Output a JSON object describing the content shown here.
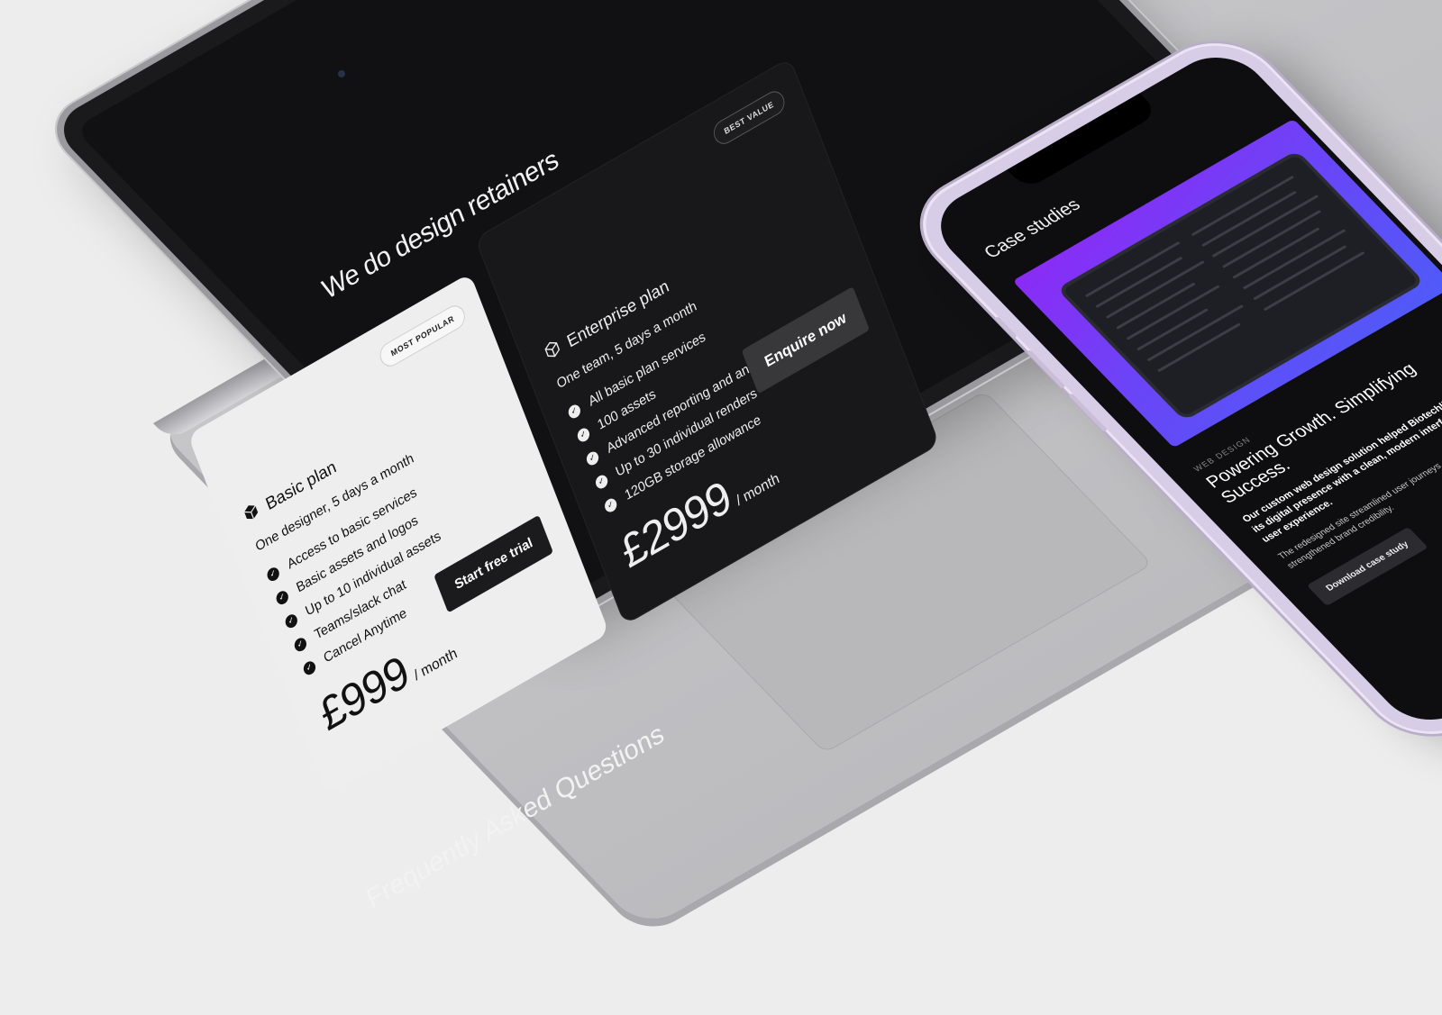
{
  "laptop": {
    "heading": "We do design retainers",
    "faq_heading": "Frequently Asked Questions",
    "plans": [
      {
        "badge": "MOST POPULAR",
        "title": "Basic plan",
        "subtitle": "One designer, 5 days a month",
        "features": [
          "Access to basic services",
          "Basic assets and logos",
          "Up to 10 individual assets",
          "Teams/slack chat",
          "Cancel Anytime"
        ],
        "price": "£999",
        "period": "/ month",
        "cta": "Start free trial"
      },
      {
        "badge": "BEST VALUE",
        "title": "Enterprise plan",
        "subtitle": "One team, 5 days a month",
        "features": [
          "All basic plan services",
          "100 assets",
          "Advanced reporting and analytics",
          "Up to 30 individual renders",
          "120GB storage allowance"
        ],
        "price": "£2999",
        "period": "/ month",
        "cta": "Enquire now"
      }
    ]
  },
  "phone": {
    "heading": "Case studies",
    "tag": "WEB DESIGN",
    "title": "Powering Growth. Simplifying Success.",
    "body": "Our custom web design solution helped Biotechlist Ltd elevate its digital presence with a clean, modern interface and intuitive user experience.",
    "body2": "The redesigned site streamlined user journeys, improved accessibility, and strengthened brand credibility.",
    "cta": "Download case study"
  },
  "colors": {
    "background": "#ededed",
    "screen": "#111113",
    "basic_card": "#eeeeef",
    "enterprise_card": "#18181a",
    "hero_start": "#8b2bf5",
    "hero_end": "#4f5bf8",
    "accent_orange": "#ff6a2f"
  }
}
